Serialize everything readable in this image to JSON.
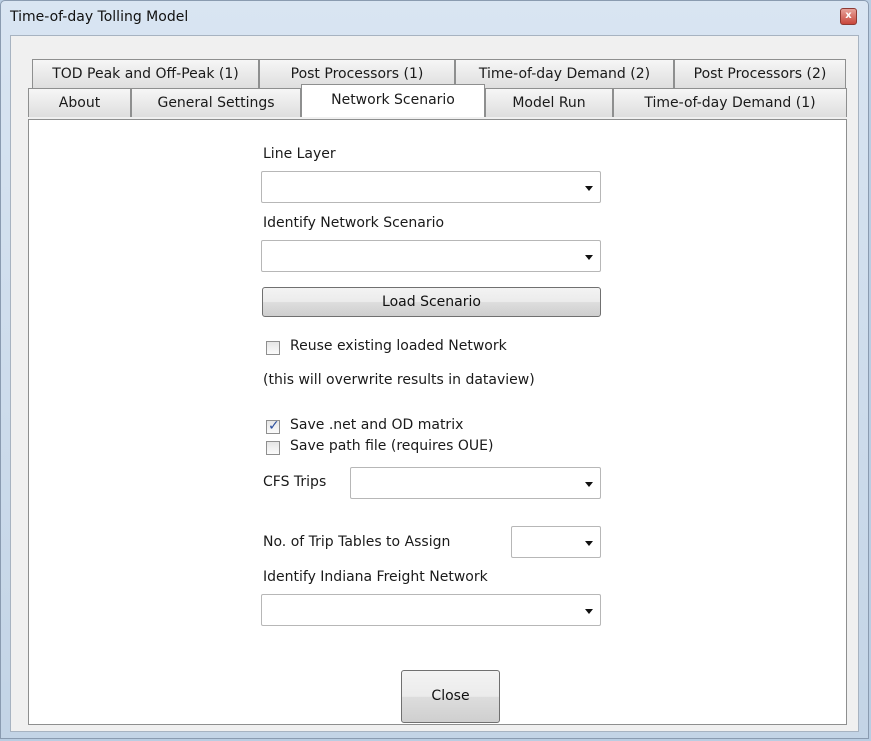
{
  "window": {
    "title": "Time-of-day Tolling Model",
    "close_glyph": "x"
  },
  "tabs": {
    "row1": [
      "TOD Peak and Off-Peak (1)",
      "Post Processors (1)",
      "Time-of-day Demand (2)",
      "Post Processors (2)"
    ],
    "row2": [
      "About",
      "General Settings",
      "Network Scenario",
      "Model Run",
      "Time-of-day Demand (1)"
    ],
    "active": "Network Scenario"
  },
  "form": {
    "line_layer": {
      "label": "Line Layer",
      "value": ""
    },
    "network_scenario": {
      "label": "Identify Network Scenario",
      "value": ""
    },
    "load_scenario_button": "Load Scenario",
    "reuse_network": {
      "label": "Reuse existing loaded Network",
      "checked": false
    },
    "overwrite_note": "(this will overwrite results in dataview)",
    "save_net_od": {
      "label": "Save .net and OD matrix",
      "checked": true
    },
    "save_path": {
      "label": "Save path file (requires OUE)",
      "checked": false
    },
    "cfs_trips": {
      "label": "CFS Trips",
      "value": ""
    },
    "trip_tables": {
      "label": "No. of Trip Tables to Assign",
      "value": ""
    },
    "freight_network": {
      "label": "Identify Indiana Freight Network",
      "value": ""
    },
    "close_button": "Close"
  },
  "icons": {
    "dropdown_arrow": "chevron-down-icon",
    "check": "checkmark-icon",
    "check_glyph": "✓"
  },
  "colors": {
    "window_frame": "#c3d4e6",
    "close_button": "#c9473b",
    "checkmark": "#2c4f9e"
  }
}
